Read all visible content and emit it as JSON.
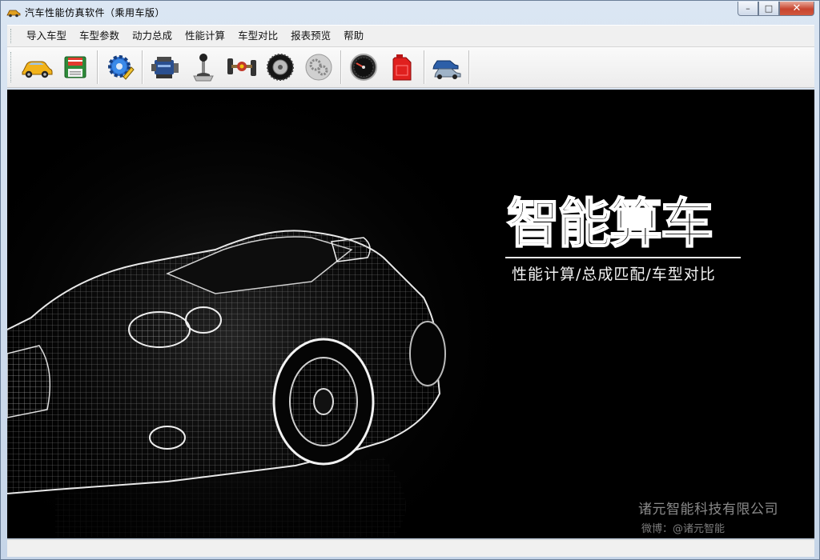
{
  "window": {
    "title": "汽车性能仿真软件（乘用车版）",
    "controls": {
      "minimize": "–",
      "maximize": "□",
      "close": "✕"
    }
  },
  "menu": {
    "items": [
      "导入车型",
      "车型参数",
      "动力总成",
      "性能计算",
      "车型对比",
      "报表预览",
      "帮助"
    ]
  },
  "toolbar": {
    "icons": [
      "car-icon",
      "save-icon",
      "settings-gear-icon",
      "engine-icon",
      "gear-shifter-icon",
      "drivetrain-icon",
      "tire-icon",
      "gears-icon",
      "speedometer-icon",
      "fuel-can-icon",
      "car-compare-icon"
    ]
  },
  "splash": {
    "logo_title": "智能算车",
    "logo_subtitle": "性能计算/总成匹配/车型对比",
    "company": "诸元智能科技有限公司",
    "weibo": "微博：@诸元智能"
  },
  "colors": {
    "accent_close": "#c7452f",
    "background": "#000000",
    "chrome": "#f0f0f0"
  }
}
